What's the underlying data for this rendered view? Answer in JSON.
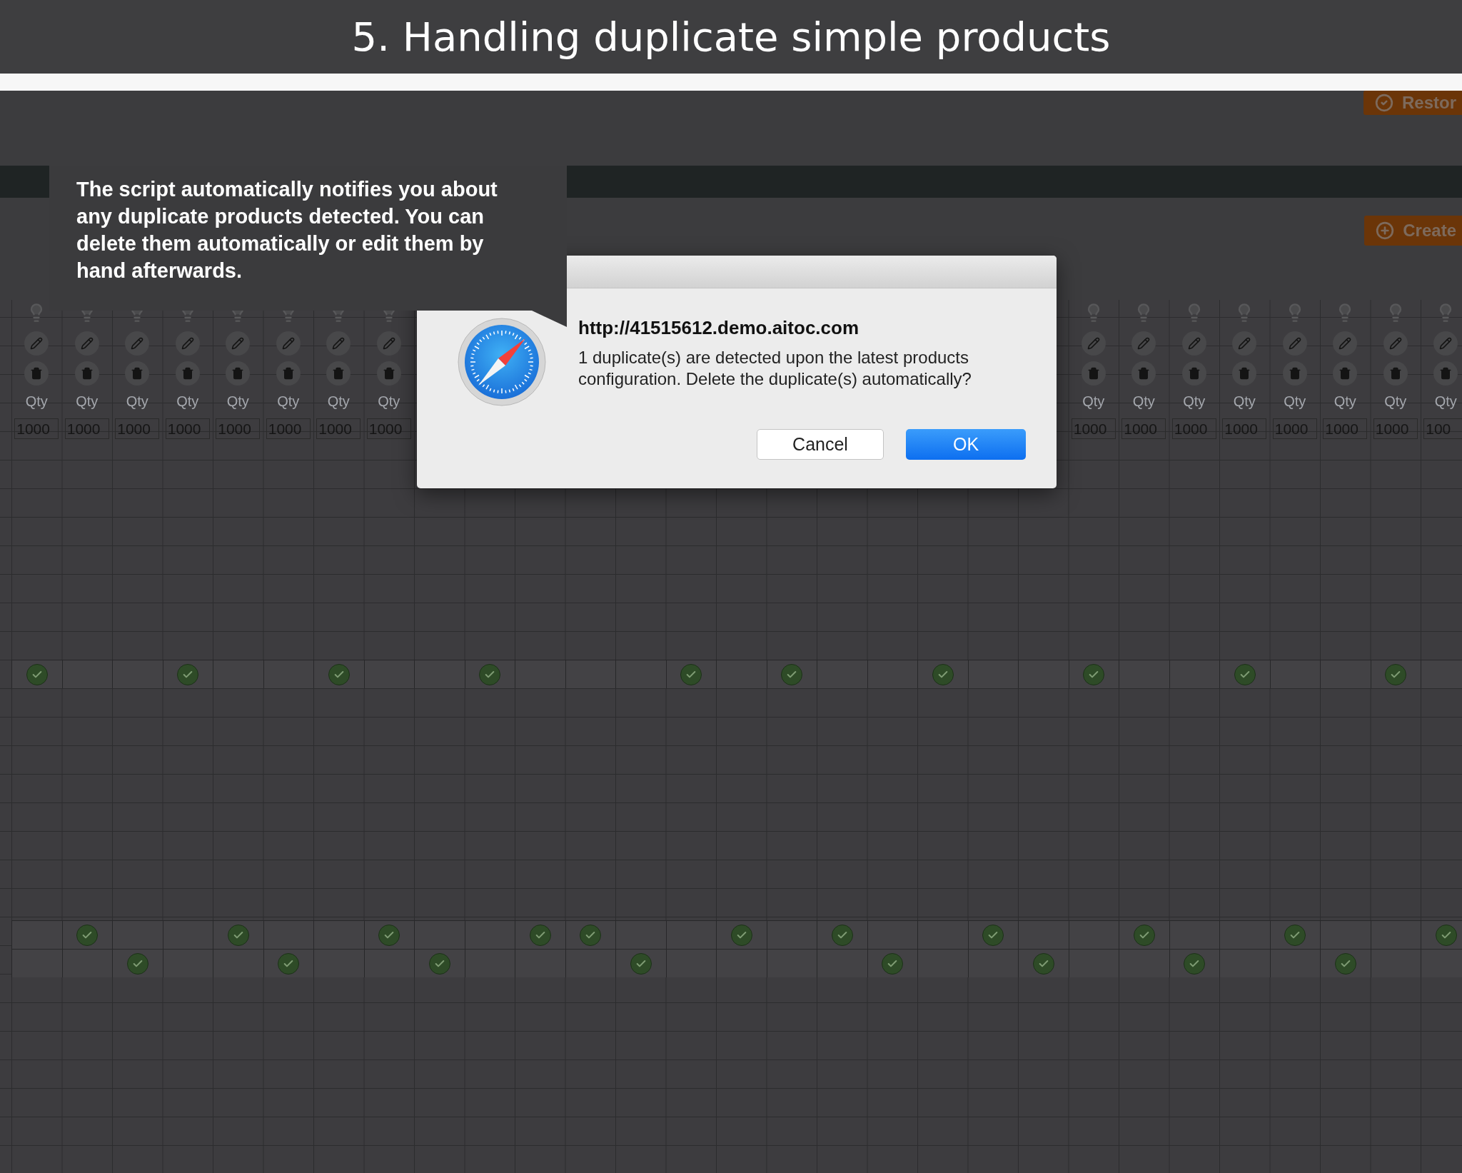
{
  "header": {
    "title": "5. Handling duplicate simple products"
  },
  "toolbar": {
    "buttons": [
      {
        "label": "Restor",
        "kind": "restore"
      },
      {
        "label": "Create",
        "kind": "create"
      }
    ]
  },
  "product_columns_left": [
    {
      "label": "Qty",
      "qty": "1000"
    },
    {
      "label": "Qty",
      "qty": "1000"
    },
    {
      "label": "Qty",
      "qty": "1000"
    },
    {
      "label": "Qty",
      "qty": "1000"
    },
    {
      "label": "Qty",
      "qty": "1000"
    },
    {
      "label": "Qty",
      "qty": "1000"
    },
    {
      "label": "Qty",
      "qty": "1000"
    },
    {
      "label": "Qty",
      "qty": "1000"
    }
  ],
  "product_columns_right": [
    {
      "label": "Qty",
      "qty": "1000"
    },
    {
      "label": "Qty",
      "qty": "1000"
    },
    {
      "label": "Qty",
      "qty": "1000"
    },
    {
      "label": "Qty",
      "qty": "1000"
    },
    {
      "label": "Qty",
      "qty": "1000"
    },
    {
      "label": "Qty",
      "qty": "1000"
    },
    {
      "label": "Qty",
      "qty": "1000"
    },
    {
      "label": "Qty",
      "qty": "100"
    }
  ],
  "check_rows": [
    {
      "checked": [
        true,
        false,
        false,
        true,
        false,
        false,
        true,
        false,
        false,
        true,
        false,
        false,
        false,
        true,
        false,
        true,
        false,
        false,
        true,
        false,
        false,
        true,
        false,
        false,
        true,
        false,
        false,
        true,
        false
      ]
    },
    {
      "checked": [
        false,
        true,
        false,
        false,
        true,
        false,
        false,
        true,
        false,
        false,
        true,
        true,
        false,
        false,
        true,
        false,
        true,
        false,
        false,
        true,
        false,
        false,
        true,
        false,
        false,
        true,
        false,
        false,
        true
      ]
    },
    {
      "checked": [
        false,
        false,
        true,
        false,
        false,
        true,
        false,
        false,
        true,
        false,
        false,
        false,
        true,
        false,
        false,
        false,
        false,
        true,
        false,
        false,
        true,
        false,
        false,
        true,
        false,
        false,
        true,
        false,
        false
      ]
    }
  ],
  "tooltip": {
    "text": "The script automatically notifies you about any duplicate products detected. You can delete them automatically or edit them by hand afterwards."
  },
  "dialog": {
    "title": "http://41515612.demo.aitoc.com",
    "message": "1 duplicate(s) are detected upon the latest products configuration. Delete the duplicate(s) automatically?",
    "buttons": [
      {
        "label": "Cancel",
        "kind": "secondary"
      },
      {
        "label": "OK",
        "kind": "primary"
      }
    ]
  }
}
